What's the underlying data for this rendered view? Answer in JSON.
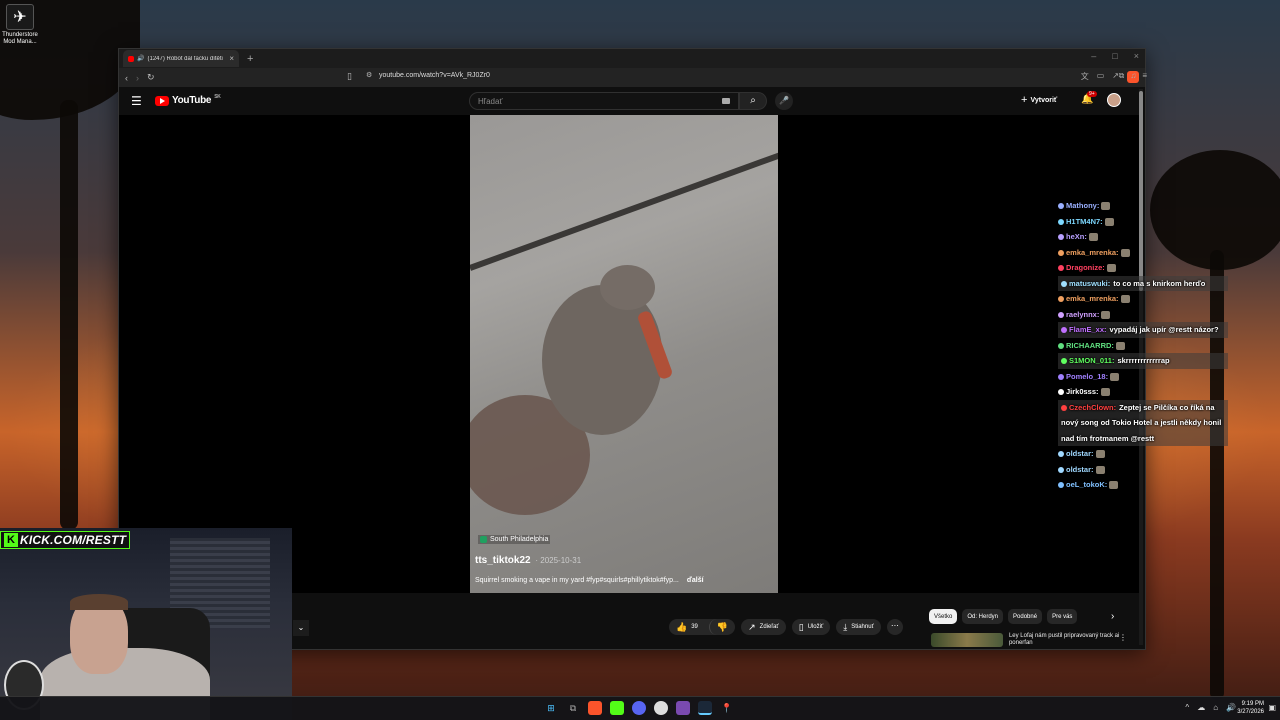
{
  "desktop": {
    "shortcut_label": "Thunderstore Mod Mana..."
  },
  "browser": {
    "tab_title": "(1247) Robot dal facku dítěti",
    "tab_close": "×",
    "new_tab": "+",
    "url": "youtube.com/watch?v=AVk_RJ0Zr0",
    "window_controls": [
      "–",
      "□",
      "×"
    ]
  },
  "youtube": {
    "logo_text": "YouTube",
    "region": "SK",
    "search_placeholder": "Hľadať",
    "create_label": "Vytvoriť",
    "notification_count": "9+",
    "video": {
      "location": "South Philadelphia",
      "username": "tts_tiktok22",
      "date": "· 2025-10-31",
      "description": "Squirrel smoking a vape in my yard #fyp#squirls#phillytiktok#fyp...",
      "more_label": "ďalší"
    },
    "actions": {
      "like_count": "39",
      "share_label": "Zdieľať",
      "save_label": "Uložiť",
      "download_label": "Stiahnuť"
    },
    "chips": [
      "Všetko",
      "Od: Herdyn",
      "Podobné",
      "Pre vás"
    ],
    "recommendation_title": "Ley Lofaj nám pustil pripravovaný track ai ponerfan"
  },
  "chat": [
    {
      "user": "Mathony:",
      "color": "#9ab0ff",
      "text": ""
    },
    {
      "user": "H1TM4N7:",
      "color": "#7dd8ff",
      "text": ""
    },
    {
      "user": "heXn:",
      "color": "#b8a0ff",
      "text": ""
    },
    {
      "user": "emka_mrenka:",
      "color": "#f0a060",
      "text": ""
    },
    {
      "user": "Dragonize:",
      "color": "#ff4060",
      "text": ""
    },
    {
      "user": "matuswuki:",
      "color": "#a0e0ff",
      "text": "to co ma s knirkom herďo"
    },
    {
      "user": "emka_mrenka:",
      "color": "#f0a060",
      "text": ""
    },
    {
      "user": "raelynnx:",
      "color": "#d0a0ff",
      "text": ""
    },
    {
      "user": "FlamE_xx:",
      "color": "#c070ff",
      "text": "vypadáj jak upír @restt názor?"
    },
    {
      "user": "RICHAARRD:",
      "color": "#60e080",
      "text": ""
    },
    {
      "user": "S1MON_011:",
      "color": "#60ff60",
      "text": "skrrrrrrrrrrrrap"
    },
    {
      "user": "Pomelo_18:",
      "color": "#a080ff",
      "text": ""
    },
    {
      "user": "Jirk0sss:",
      "color": "#ffffff",
      "text": ""
    },
    {
      "user": "CzechClown:",
      "color": "#ff4040",
      "text": "Zeptej se Pilčíka co říká na nový song od Tokio Hotel a jestli někdy honil nad tím frotmanem @restt"
    },
    {
      "user": "oldstar:",
      "color": "#a0d8ff",
      "text": ""
    },
    {
      "user": "oldstar:",
      "color": "#a0d8ff",
      "text": ""
    },
    {
      "user": "oeL_tokoK:",
      "color": "#80c0ff",
      "text": ""
    }
  ],
  "stream": {
    "kick_handle": "KICK.COM/RESTT"
  },
  "taskbar": {
    "time": "9:19 PM",
    "date": "3/27/2026"
  }
}
